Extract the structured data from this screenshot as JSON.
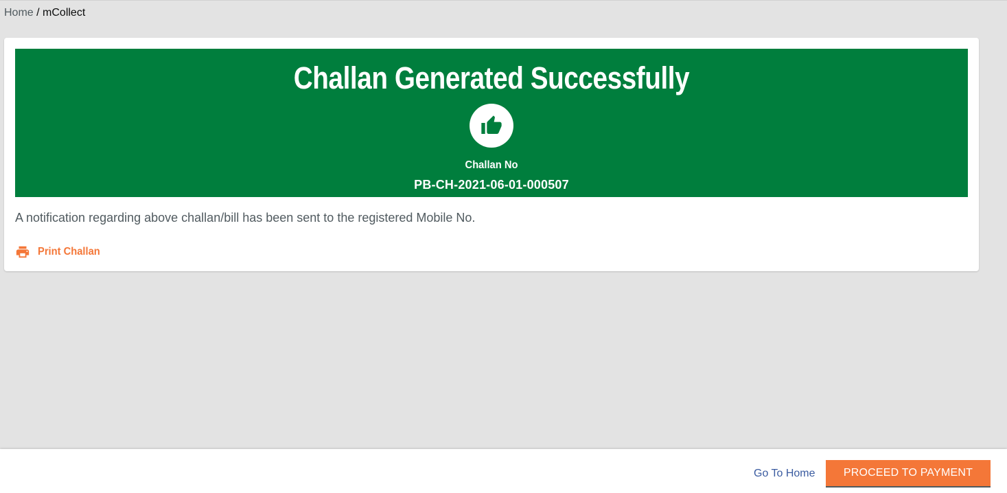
{
  "breadcrumb": {
    "home": "Home",
    "separator": " / ",
    "current": "mCollect"
  },
  "banner": {
    "title": "Challan Generated Successfully",
    "icon": "thumbs-up-icon",
    "challan_label": "Challan No",
    "challan_number": "PB-CH-2021-06-01-000507",
    "background_color": "#007e3d"
  },
  "notification": "A notification regarding above challan/bill has been sent to the registered Mobile No.",
  "print": {
    "icon": "printer-icon",
    "label": "Print Challan"
  },
  "actions": {
    "go_home": "Go To Home",
    "proceed": "PROCEED TO PAYMENT",
    "accent_color": "#f47738"
  }
}
